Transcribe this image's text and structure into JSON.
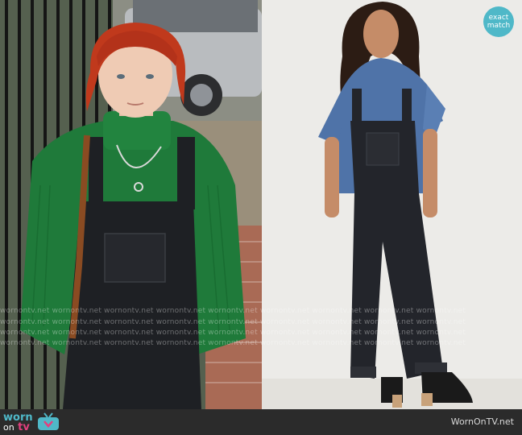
{
  "badge": {
    "line1": "exact",
    "line2": "match"
  },
  "watermark": {
    "text": "wornontv.net  wornontv.net  wornontv.net  wornontv.net  wornontv.net  wornontv.net  wornontv.net  wornontv.net  wornontv.net"
  },
  "footer": {
    "logo_worn": "worn",
    "logo_on": "on",
    "logo_tv": "tv",
    "site_label": "WornOnTV.net"
  },
  "colors": {
    "brand_teal": "#4fb8c8",
    "brand_pink": "#e2407e",
    "footer_bg": "#2b2b2b"
  }
}
